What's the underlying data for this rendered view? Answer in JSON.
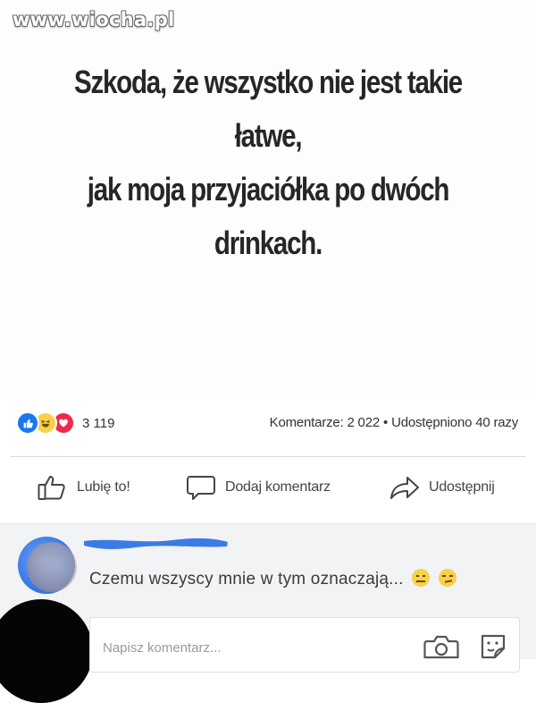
{
  "watermark": "www.wiocha.pl",
  "post": {
    "quote_lines": [
      "Szkoda, że wszystko nie jest takie",
      "łatwe,",
      "jak moja przyjaciółka po dwóch",
      "drinkach."
    ]
  },
  "stats": {
    "reaction_icons": [
      "like-icon",
      "haha-icon",
      "love-icon"
    ],
    "reaction_count": "3 119",
    "comments": "Komentarze: 2 022",
    "separator": "•",
    "shares": "Udostępniono 40 razy"
  },
  "actions": {
    "like": "Lubię to!",
    "comment": "Dodaj komentarz",
    "share": "Udostępnij"
  },
  "comment": {
    "text": "Czemu wszyscy mnie w tym oznaczają...",
    "emojis": [
      "neutral-emoji-icon",
      "smirk-emoji-icon"
    ]
  },
  "write": {
    "placeholder": "Napisz komentarz..."
  },
  "colors": {
    "facebook_blue": "#1877f2",
    "love_red": "#f0284a",
    "haha_yellow": "#f7d14a",
    "redaction_blue": "#3b7be8"
  }
}
